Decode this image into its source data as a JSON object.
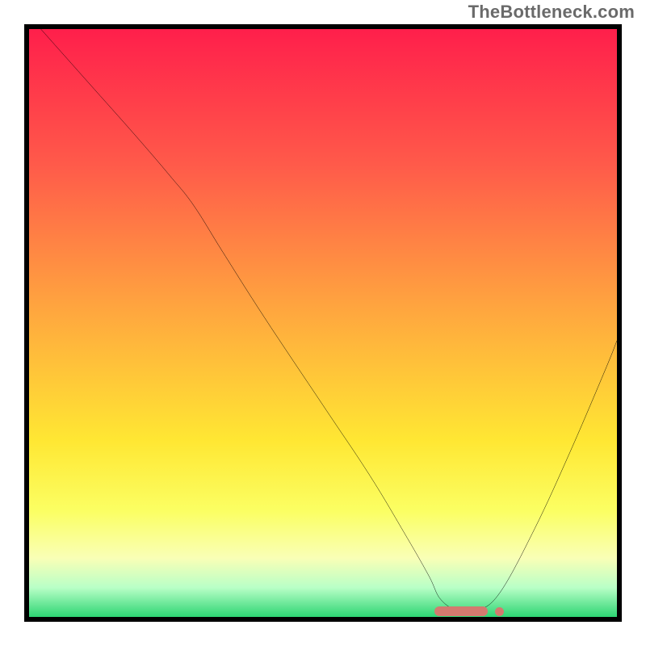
{
  "watermark": "TheBottleneck.com",
  "chart_data": {
    "type": "line",
    "title": "",
    "xlabel": "",
    "ylabel": "",
    "xlim": [
      0,
      100
    ],
    "ylim": [
      0,
      100
    ],
    "grid": false,
    "legend": false,
    "background_gradient_stops": [
      {
        "offset": 0.0,
        "color": "#ff1f4b"
      },
      {
        "offset": 0.23,
        "color": "#ff5a4a"
      },
      {
        "offset": 0.47,
        "color": "#ffa43f"
      },
      {
        "offset": 0.7,
        "color": "#ffe733"
      },
      {
        "offset": 0.82,
        "color": "#fbff63"
      },
      {
        "offset": 0.9,
        "color": "#f9ffb6"
      },
      {
        "offset": 0.95,
        "color": "#b9ffc7"
      },
      {
        "offset": 1.0,
        "color": "#2dd573"
      }
    ],
    "series": [
      {
        "name": "curve",
        "color": "#000000",
        "x": [
          2,
          10,
          18,
          24,
          28,
          33,
          40,
          50,
          58,
          64,
          68,
          70,
          73,
          76,
          80,
          86,
          92,
          98,
          100
        ],
        "y": [
          100,
          91,
          82,
          75,
          70,
          62,
          51,
          36,
          24,
          14,
          7,
          3,
          1,
          1,
          4,
          15,
          28,
          42,
          47
        ]
      }
    ],
    "optimal_region": {
      "x_start": 69,
      "x_end": 78,
      "dot_x": 80
    }
  }
}
